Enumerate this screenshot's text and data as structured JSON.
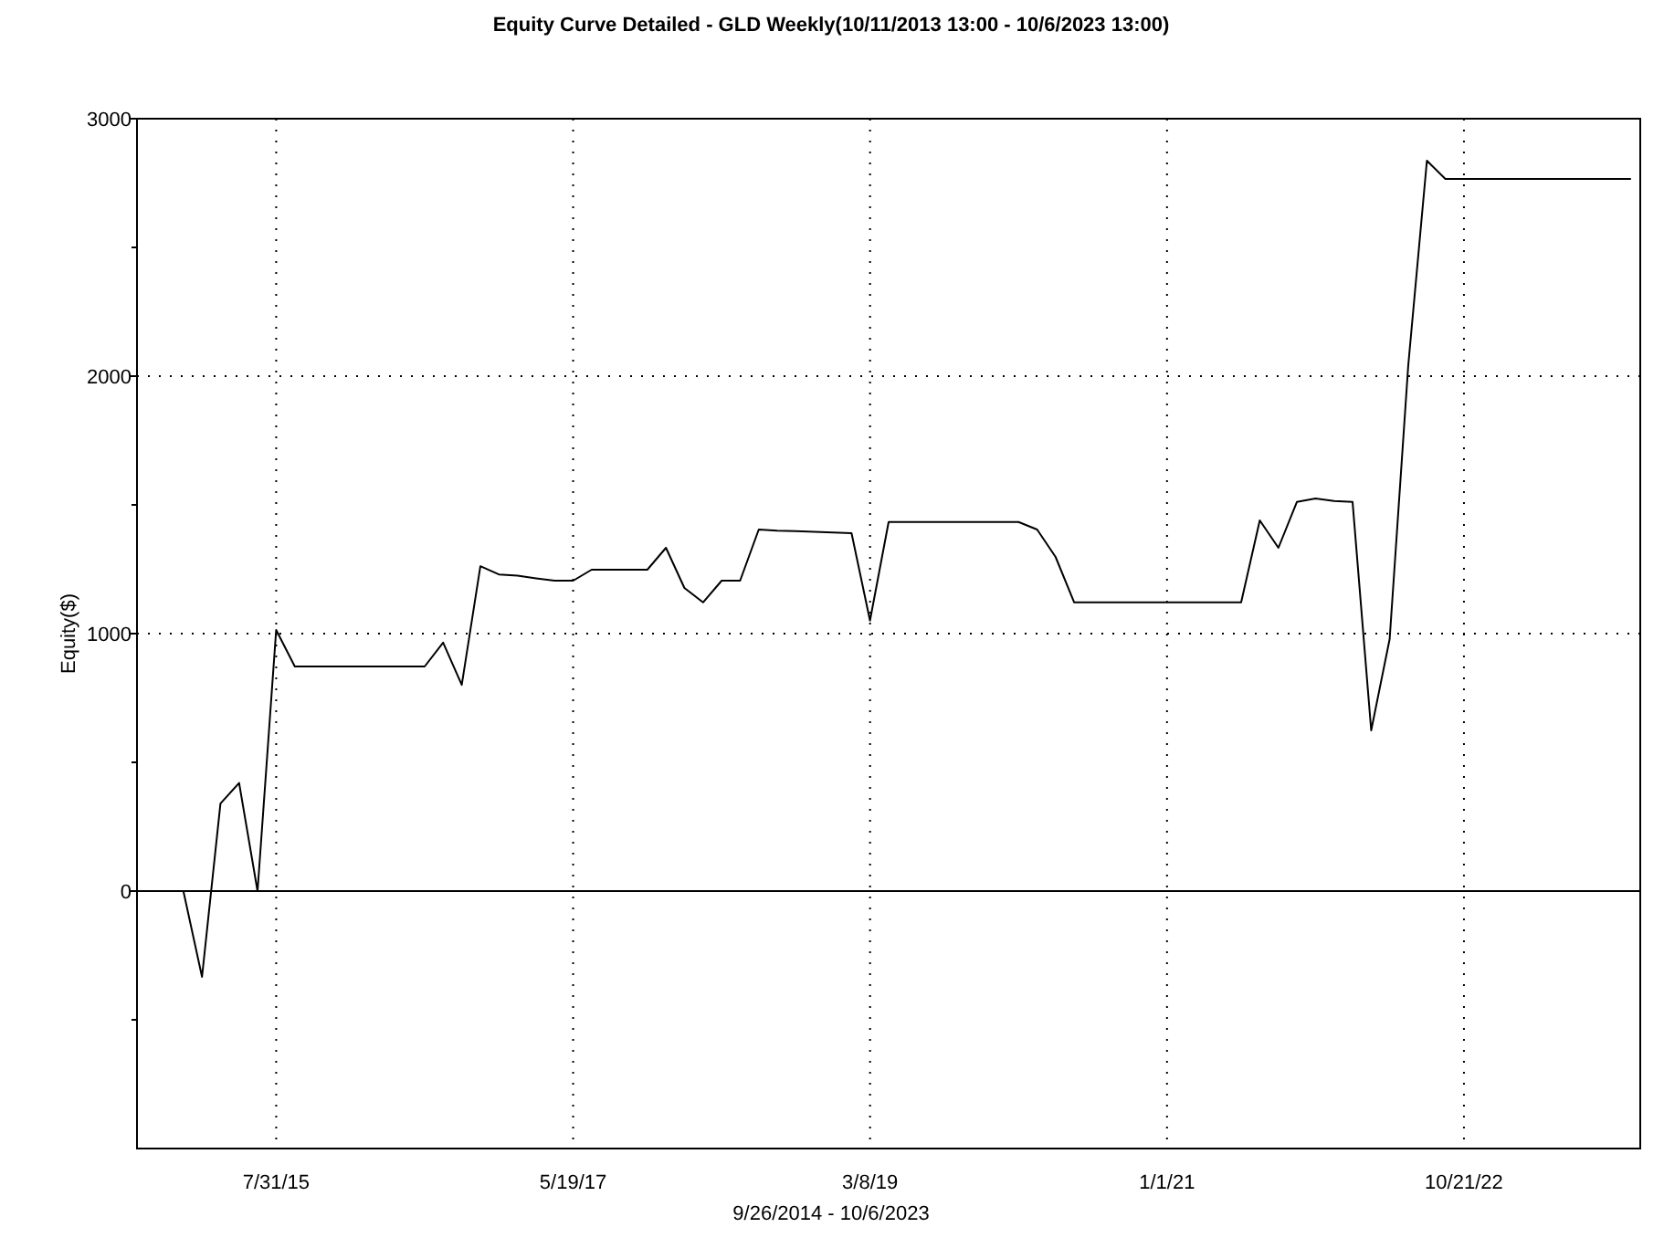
{
  "chart_data": {
    "type": "line",
    "title": "Equity Curve Detailed - GLD Weekly(10/11/2013 13:00 - 10/6/2023 13:00)",
    "xlabel": "9/26/2014 - 10/6/2023",
    "ylabel": "Equity($)",
    "ylim": [
      -1000,
      3000
    ],
    "yticks": [
      0,
      1000,
      2000,
      3000
    ],
    "grid": true,
    "categories": [
      null,
      null,
      null,
      null,
      null,
      null,
      null,
      "7/31/15",
      null,
      null,
      null,
      null,
      null,
      null,
      null,
      null,
      null,
      null,
      null,
      null,
      null,
      null,
      null,
      "5/19/17",
      null,
      null,
      null,
      null,
      null,
      null,
      null,
      null,
      null,
      null,
      null,
      null,
      null,
      null,
      null,
      "3/8/19",
      null,
      null,
      null,
      null,
      null,
      null,
      null,
      null,
      null,
      null,
      null,
      null,
      null,
      null,
      null,
      "1/1/21",
      null,
      null,
      null,
      null,
      null,
      null,
      null,
      null,
      null,
      null,
      null,
      null,
      null,
      null,
      null,
      "10/21/22",
      null,
      null,
      null,
      null,
      null,
      null,
      null,
      null,
      null
    ],
    "series": [
      {
        "color": "#000000",
        "values": [
          null,
          null,
          0,
          -333,
          340,
          420,
          0,
          1014,
          872,
          872,
          872,
          872,
          872,
          872,
          872,
          872,
          965,
          801,
          1262,
          1230,
          1225,
          1215,
          1206,
          1206,
          1248,
          1248,
          1248,
          1248,
          1333,
          1177,
          1121,
          1206,
          1206,
          1404,
          1400,
          1398,
          1395,
          1393,
          1390,
          1050,
          1433,
          1433,
          1433,
          1433,
          1433,
          1433,
          1433,
          1433,
          1404,
          1298,
          1121,
          1121,
          1121,
          1121,
          1121,
          1121,
          1121,
          1121,
          1121,
          1121,
          1440,
          1333,
          1511,
          1525,
          1515,
          1511,
          624,
          979,
          2043,
          2837,
          2766,
          2766,
          2766,
          2766,
          2766,
          2766,
          2766,
          2766,
          2766,
          2766,
          2766
        ]
      }
    ]
  }
}
